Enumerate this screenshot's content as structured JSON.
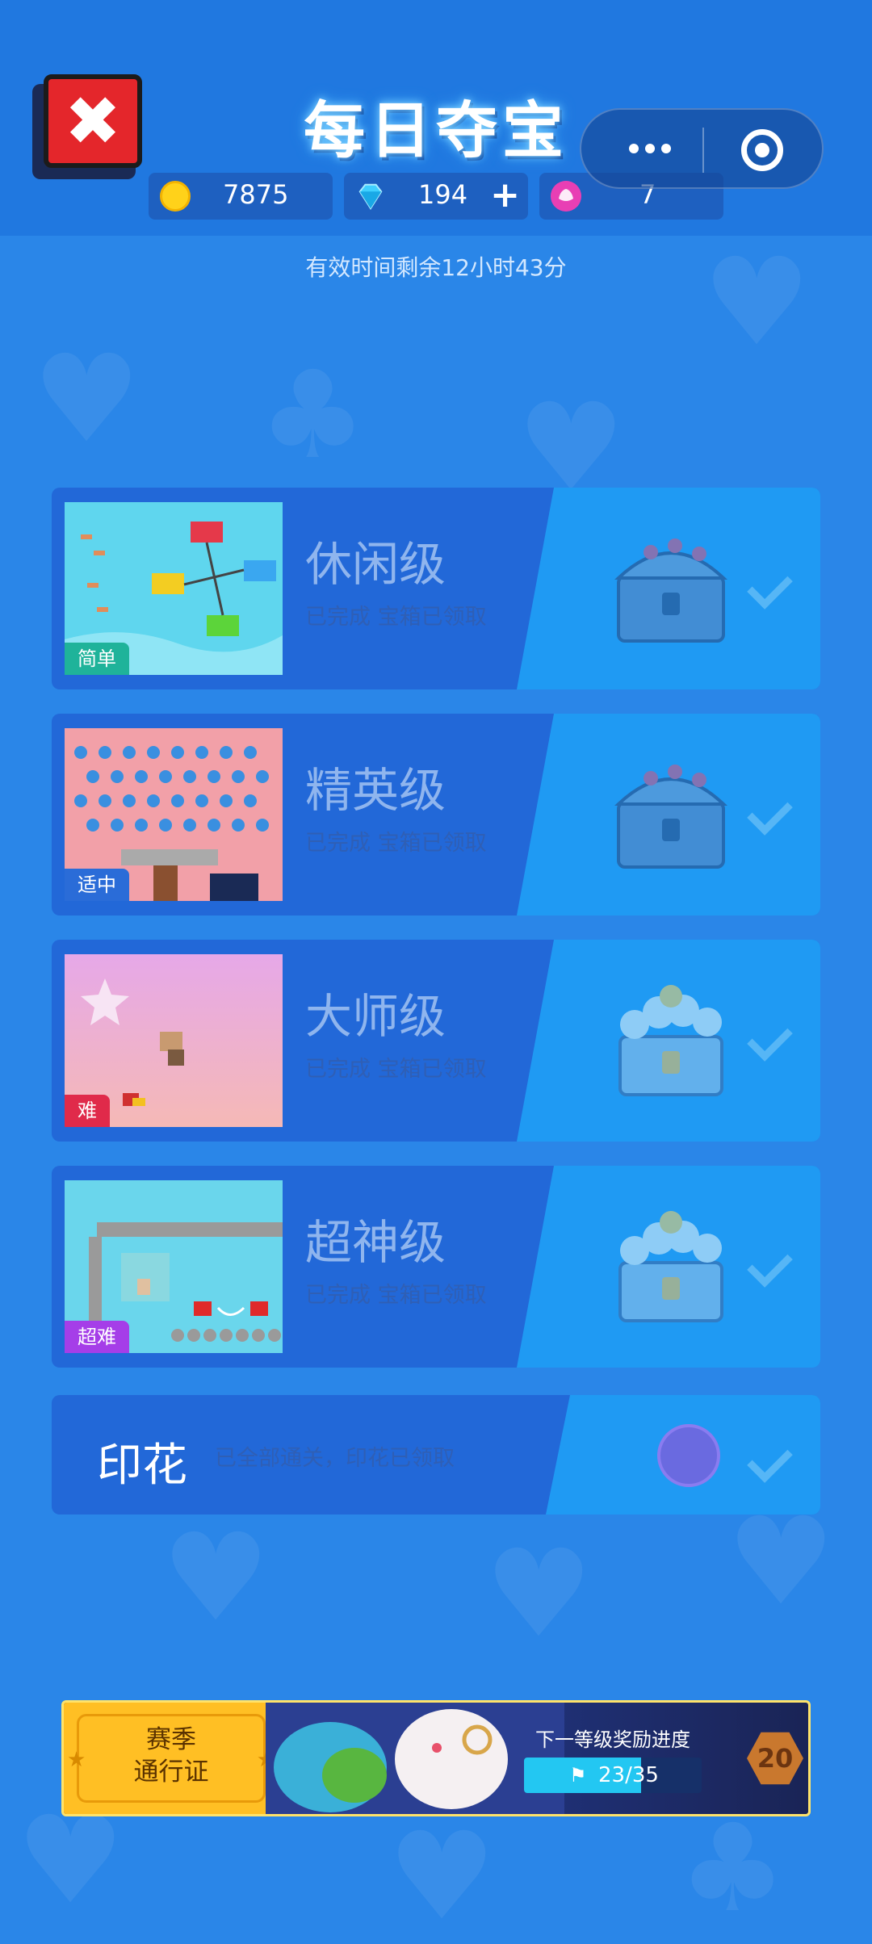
{
  "header": {
    "title": "每日夺宝",
    "close_icon": "close-icon"
  },
  "resources": {
    "coins": "7875",
    "gems": "194",
    "gem_plus": "+",
    "stamps": "7"
  },
  "timer_text": "有效时间剩余12小时43分",
  "levels": [
    {
      "name": "休闲级",
      "difficulty": "简单",
      "status": "已完成 宝箱已领取",
      "difficulty_color": "#1fb39a"
    },
    {
      "name": "精英级",
      "difficulty": "适中",
      "status": "已完成 宝箱已领取",
      "difficulty_color": "#2a6cd8"
    },
    {
      "name": "大师级",
      "difficulty": "难",
      "status": "已完成 宝箱已领取",
      "difficulty_color": "#e02a4a"
    },
    {
      "name": "超神级",
      "difficulty": "超难",
      "status": "已完成 宝箱已领取",
      "difficulty_color": "#a53ee8"
    }
  ],
  "stamp_row": {
    "title": "印花",
    "status": "已全部通关，印花已领取"
  },
  "banner": {
    "pass_label": "赛季\n通行证",
    "reward_title": "下一等级奖励进度",
    "progress_text": "23/35",
    "progress_value": 0.657,
    "level": "20"
  }
}
